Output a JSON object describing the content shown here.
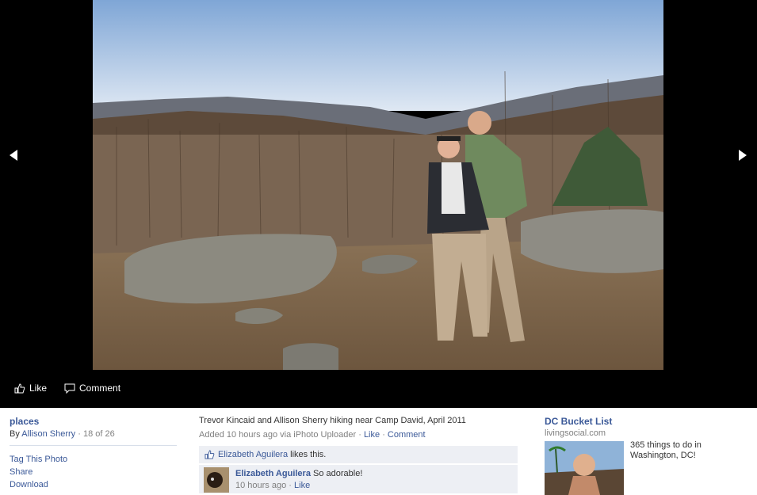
{
  "photo": {
    "alt": "Trevor Kincaid and Allison Sherry hiking near Camp David, April 2011"
  },
  "stage_actions": {
    "like_label": "Like",
    "comment_label": "Comment"
  },
  "album": {
    "title": "places",
    "by_prefix": "By",
    "author": "Allison Sherry",
    "separator": "·",
    "position": "18 of 26"
  },
  "photo_actions": {
    "tag": "Tag This Photo",
    "share": "Share",
    "download": "Download"
  },
  "details": {
    "caption": "Trevor Kincaid and Allison Sherry hiking near Camp David, April 2011",
    "added_text": "Added 10 hours ago via iPhoto Uploader",
    "separator": "·",
    "like_link": "Like",
    "comment_link": "Comment"
  },
  "likes": {
    "person": "Elizabeth Aguilera",
    "suffix": "likes this."
  },
  "comment": {
    "author": "Elizabeth Aguilera",
    "text": "So adorable!",
    "time": "10 hours ago",
    "separator": "·",
    "like_link": "Like"
  },
  "ad": {
    "title": "DC Bucket List",
    "domain": "livingsocial.com",
    "text": "365 things to do in Washington, DC!"
  },
  "colors": {
    "link": "#3b5998",
    "stage_bg": "#000000",
    "panel_bg": "#edeff4"
  }
}
